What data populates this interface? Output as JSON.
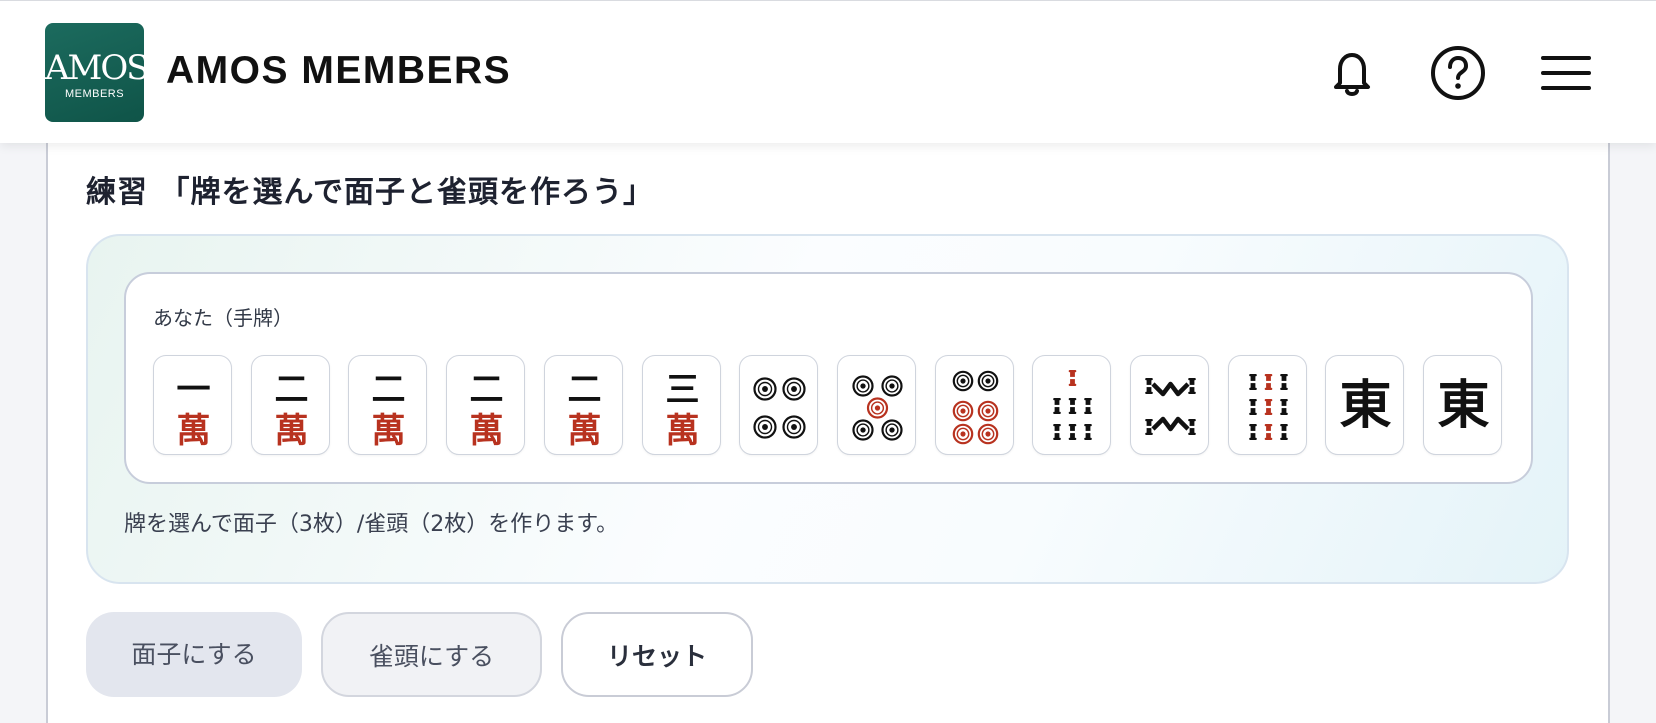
{
  "header": {
    "logo_main": "AMOS",
    "logo_sub": "MEMBERS",
    "brand": "AMOS MEMBERS",
    "icons": [
      "bell-icon",
      "help-icon",
      "menu-icon"
    ]
  },
  "page": {
    "title": "練習 「牌を選んで面子と雀頭を作ろう」"
  },
  "hand": {
    "label": "あなた（手牌）",
    "tiles": [
      {
        "kind": "man",
        "rank": "一"
      },
      {
        "kind": "man",
        "rank": "二"
      },
      {
        "kind": "man",
        "rank": "二"
      },
      {
        "kind": "man",
        "rank": "二"
      },
      {
        "kind": "man",
        "rank": "二"
      },
      {
        "kind": "man",
        "rank": "三"
      },
      {
        "kind": "pin",
        "rank": "4"
      },
      {
        "kind": "pin",
        "rank": "5"
      },
      {
        "kind": "pin",
        "rank": "6"
      },
      {
        "kind": "sou",
        "rank": "7"
      },
      {
        "kind": "sou",
        "rank": "8"
      },
      {
        "kind": "sou",
        "rank": "9"
      },
      {
        "kind": "honor",
        "rank": "東"
      },
      {
        "kind": "honor",
        "rank": "東"
      }
    ],
    "man_char": "萬"
  },
  "hint": "牌を選んで面子（3枚）/雀頭（2枚）を作ります。",
  "buttons": {
    "meld": "面子にする",
    "pair": "雀頭にする",
    "reset": "リセット"
  },
  "colors": {
    "logo_green": "#136155",
    "man_red": "#b8321f",
    "tile_black": "#111111"
  }
}
